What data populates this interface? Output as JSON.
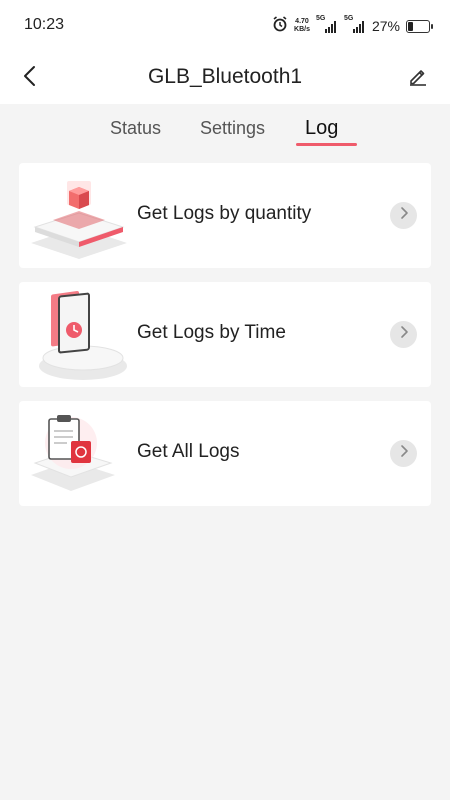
{
  "status_bar": {
    "time": "10:23",
    "net_speed_value": "4.70",
    "net_speed_unit": "KB/s",
    "signal1_label": "5G",
    "signal2_label": "5G",
    "battery_percent": "27%",
    "battery_level": 0.27,
    "icons": [
      "alarm-icon",
      "signal-icon",
      "battery-icon"
    ]
  },
  "header": {
    "title": "GLB_Bluetooth1",
    "back_icon": "chevron-left-icon",
    "edit_icon": "pencil-icon"
  },
  "tabs": [
    {
      "label": "Status",
      "active": false
    },
    {
      "label": "Settings",
      "active": false
    },
    {
      "label": "Log",
      "active": true
    }
  ],
  "colors": {
    "accent": "#ef5b6b",
    "background": "#f4f4f4",
    "card": "#ffffff"
  },
  "cards": [
    {
      "label": "Get Logs by quantity",
      "icon": "cube-platform-icon"
    },
    {
      "label": "Get Logs by Time",
      "icon": "clock-tablet-icon"
    },
    {
      "label": "Get All Logs",
      "icon": "clipboard-icon"
    }
  ]
}
